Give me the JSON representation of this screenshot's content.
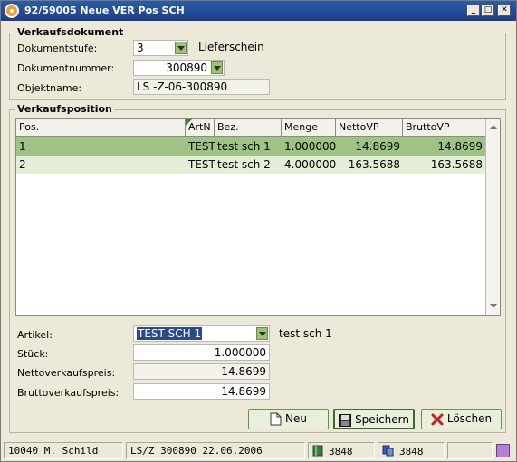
{
  "window": {
    "title": "92/59005 Neue VER Pos SCH"
  },
  "verkaufsdokument": {
    "title": "Verkaufsdokument",
    "dokumentstufe": {
      "label": "Dokumentstufe:",
      "value": "3",
      "text": "Lieferschein"
    },
    "dokumentnummer": {
      "label": "Dokumentnummer:",
      "value": "300890"
    },
    "objektname": {
      "label": "Objektname:",
      "value": "LS -Z-06-300890"
    }
  },
  "verkaufsposition": {
    "title": "Verkaufsposition",
    "columns": [
      "Pos.",
      "ArtN",
      "Bez.",
      "Menge",
      "NettoVP",
      "BruttoVP"
    ],
    "rows": [
      {
        "pos": "1",
        "artn": "TEST",
        "bez": "test sch 1",
        "menge": "1.000000",
        "netto": "14.8699",
        "brutto": "14.8699"
      },
      {
        "pos": "2",
        "artn": "TEST",
        "bez": "test sch 2",
        "menge": "4.000000",
        "netto": "163.5688",
        "brutto": "163.5688"
      }
    ],
    "artikel": {
      "label": "Artikel:",
      "value": "TEST SCH 1",
      "description": "test sch 1"
    },
    "stueck": {
      "label": "Stück:",
      "value": "1.000000"
    },
    "netto": {
      "label": "Nettoverkaufspreis:",
      "value": "14.8699"
    },
    "brutto": {
      "label": "Bruttoverkaufspreis:",
      "value": "14.8699"
    }
  },
  "buttons": {
    "neu": "Neu",
    "speichern": "Speichern",
    "loeschen": "Löschen"
  },
  "statusbar": {
    "user": "10040 M. Schild",
    "doc": "LS/Z 300890  22.06.2006",
    "count1": "3848",
    "count2": "3848"
  },
  "colors": {
    "title_bar": "#1c3f86",
    "selected_row": "#9ec383",
    "row_alt": "#e3eed7",
    "delete_icon": "#c81e1e"
  }
}
